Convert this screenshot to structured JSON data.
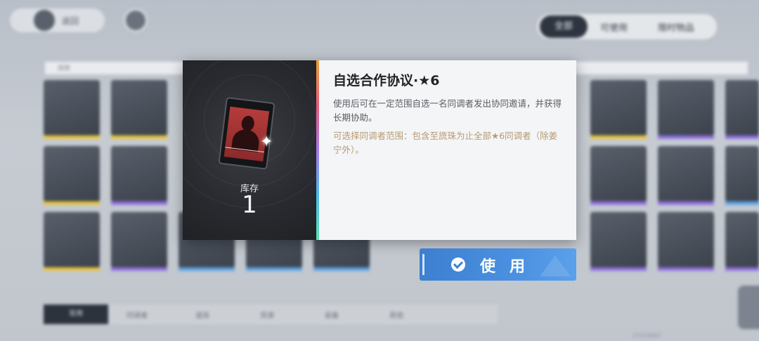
{
  "header": {
    "back_label": "返回",
    "filters": [
      "全部",
      "可使用",
      "限时物品"
    ]
  },
  "search": {
    "placeholder": "搜索"
  },
  "bottom_tabs": [
    "常用",
    "同调者",
    "道具",
    "资源",
    "装备",
    "其他",
    ""
  ],
  "uid": "27376097",
  "grid_bar_colors": [
    "#e7c53a",
    "#e7c53a",
    "#8f6fe0",
    "#8f6fe0",
    "#8f6fe0",
    "#8f6fe0",
    "#5aa2e6",
    "#5aa2e6",
    "#e7c53a"
  ],
  "item": {
    "name": "自选合作协议·★6",
    "stock_label": "库存",
    "stock_value": "1",
    "description": "使用后可在一定范围自选一名同调者发出协同邀请，并获得长期协助。",
    "range": "可选择同调者范围：包含至旒珠为止全部★6同调者（除姜宁外）。"
  },
  "use_button": {
    "label": "使用"
  },
  "colors": {
    "accent_blue": "#4b90e0",
    "range_text": "#b69a73",
    "panel_dark": "#2a2b30"
  }
}
